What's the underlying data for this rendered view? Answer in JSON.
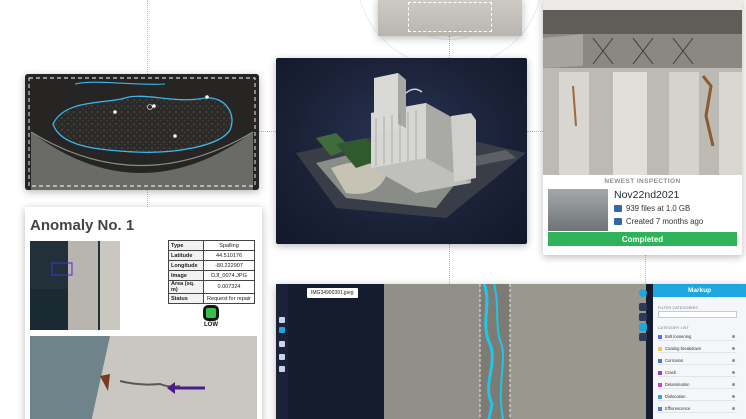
{
  "inspection": {
    "newest_label": "NEWEST INSPECTION",
    "date": "Nov22nd2021",
    "files": "939 files at 1.0 GB",
    "created": "Created 7 months ago",
    "status_button": "Completed",
    "status_color": "#2fb35a"
  },
  "anomaly": {
    "title": "Anomaly No. 1",
    "table": [
      {
        "key": "Type",
        "value": "Spalling"
      },
      {
        "key": "Latitude",
        "value": "44.510176"
      },
      {
        "key": "Longitude",
        "value": "-80.222907"
      },
      {
        "key": "Image",
        "value": "DJI_0074.JPG"
      },
      {
        "key": "Area (sq. m)",
        "value": "0.007324"
      },
      {
        "key": "Status",
        "value": "Request for repair"
      }
    ],
    "severity": "LOW",
    "severity_color": "#36c24a"
  },
  "markup": {
    "panel_title": "Markup",
    "file_name": "IMG34900391.jpeg",
    "filter_label": "FILTER CATEGORIES",
    "category_label": "CATEGORY LIST",
    "categories": [
      {
        "label": "Bolt loosening",
        "color": "#5b6fd6"
      },
      {
        "label": "Coating breakdown",
        "color": "#f1c84b"
      },
      {
        "label": "Corrosion",
        "color": "#3a7bd5"
      },
      {
        "label": "Crack",
        "color": "#9b3fc8"
      },
      {
        "label": "Delamination",
        "color": "#c74bbd"
      },
      {
        "label": "Dislocation",
        "color": "#3aa5d1"
      },
      {
        "label": "Efflorescence",
        "color": "#4f7be0"
      }
    ],
    "accent_color": "#1ea6de"
  },
  "icons": {
    "files": "images-icon",
    "created": "calendar-icon",
    "close": "close-icon"
  }
}
